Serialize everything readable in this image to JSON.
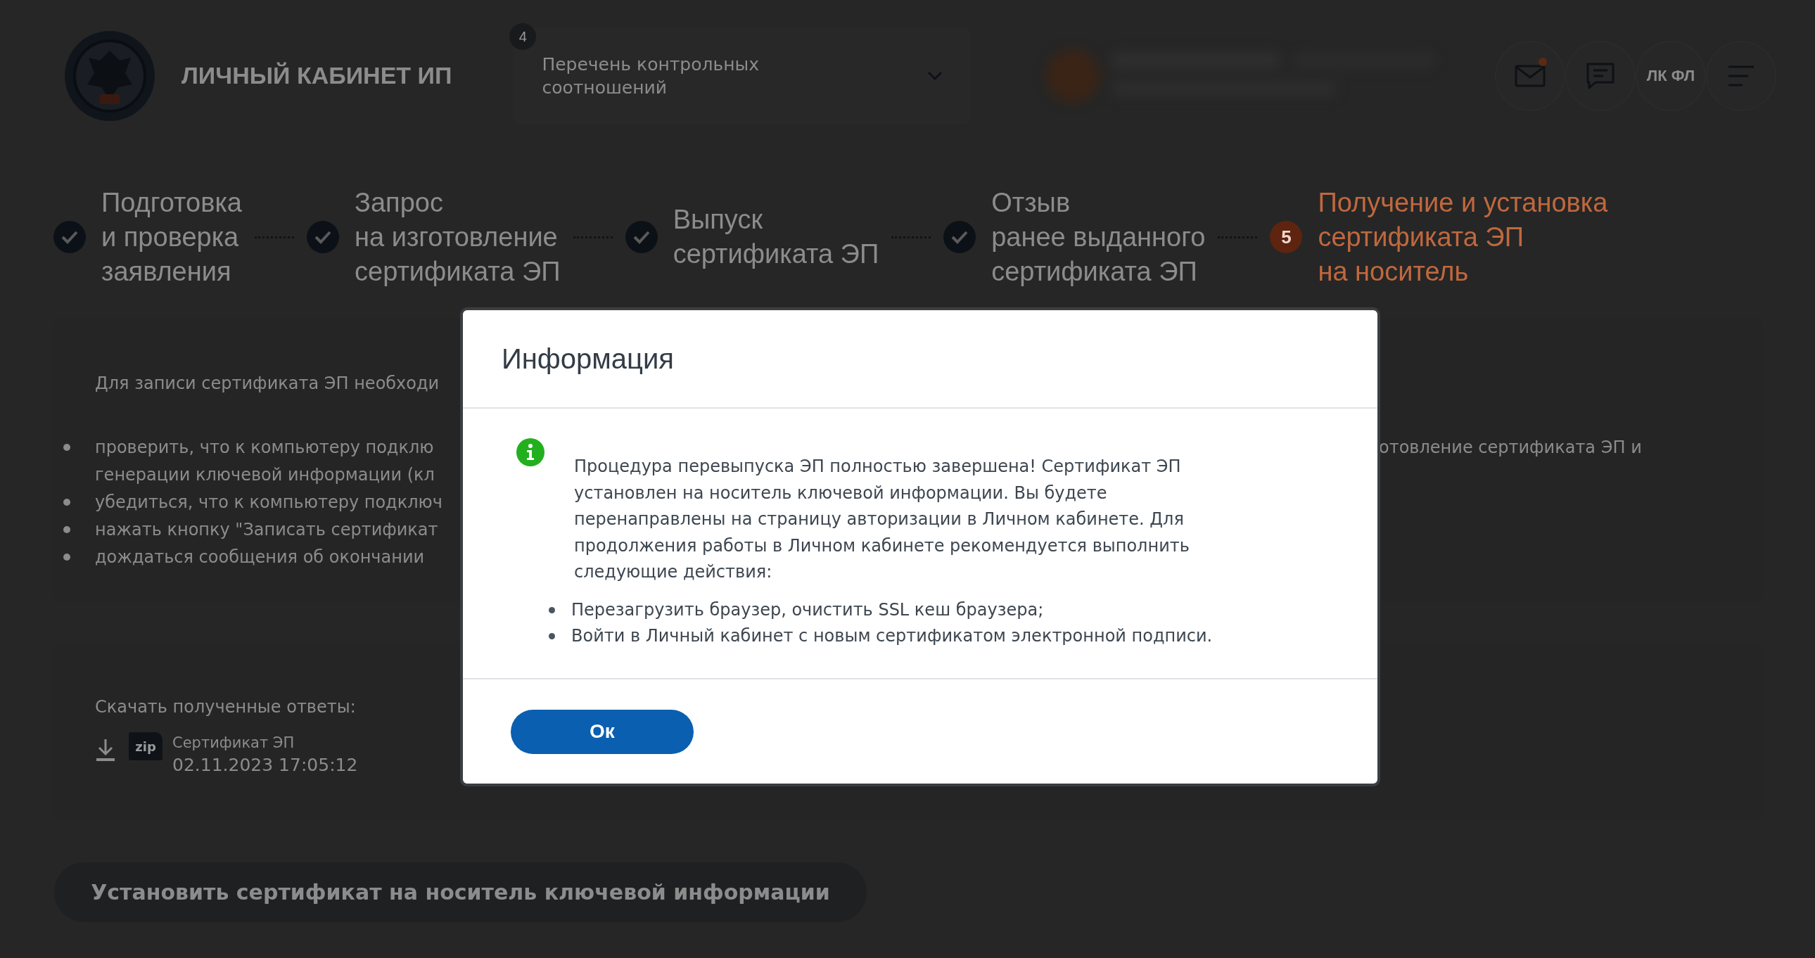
{
  "header": {
    "title": "ЛИЧНЫЙ КАБИНЕТ ИП",
    "dropdown": {
      "value": "Перечень контрольных соотношений",
      "badge": "4"
    },
    "mail_unread": true,
    "profile_button": "ЛК ФЛ"
  },
  "steps": [
    {
      "label": "Подготовка\nи проверка\nзаявления",
      "completed": true
    },
    {
      "label": "Запрос\nна изготовление\nсертификата ЭП",
      "completed": true
    },
    {
      "label": "Выпуск\nсертификата ЭП",
      "completed": true
    },
    {
      "label": "Отзыв\nранее выданного\nсертификата ЭП",
      "completed": true
    },
    {
      "label": "Получение и установка\nсертификата ЭП\nна носитель",
      "completed": false,
      "number": "5"
    }
  ],
  "instructions": {
    "intro": "Для записи сертификата ЭП необходи",
    "items": [
      {
        "text": "проверить, что к компьютеру подклю\nгенерации ключевой информации (кл",
        "continuation": "отовление сертификата ЭП и"
      },
      {
        "text": "убедиться, что к компьютеру подключ"
      },
      {
        "text": "нажать кнопку \"Записать сертификат"
      },
      {
        "text": "дождаться сообщения об окончании"
      }
    ]
  },
  "downloads": {
    "title": "Скачать полученные ответы:",
    "files": [
      {
        "type": "zip",
        "name": "Сертификат ЭП",
        "date": "02.11.2023 17:05:12"
      }
    ]
  },
  "install_button": {
    "label": "Установить сертификат на носитель ключевой информации",
    "disabled": true
  },
  "dialog": {
    "title": "Информация",
    "message": "Процедура перевыпуска ЭП полностью завершена! Сертификат ЭП установлен на носитель ключевой информации. Вы будете перенаправлены на страницу авторизации в Личном кабинете. Для продолжения работы в Личном кабинете рекомендуется выполнить следующие действия:",
    "actions": [
      "Перезагрузить браузер, очистить SSL кеш браузера;",
      "Войти в Личный кабинет с новым сертификатом электронной подписи."
    ],
    "ok_button": "Ок"
  }
}
